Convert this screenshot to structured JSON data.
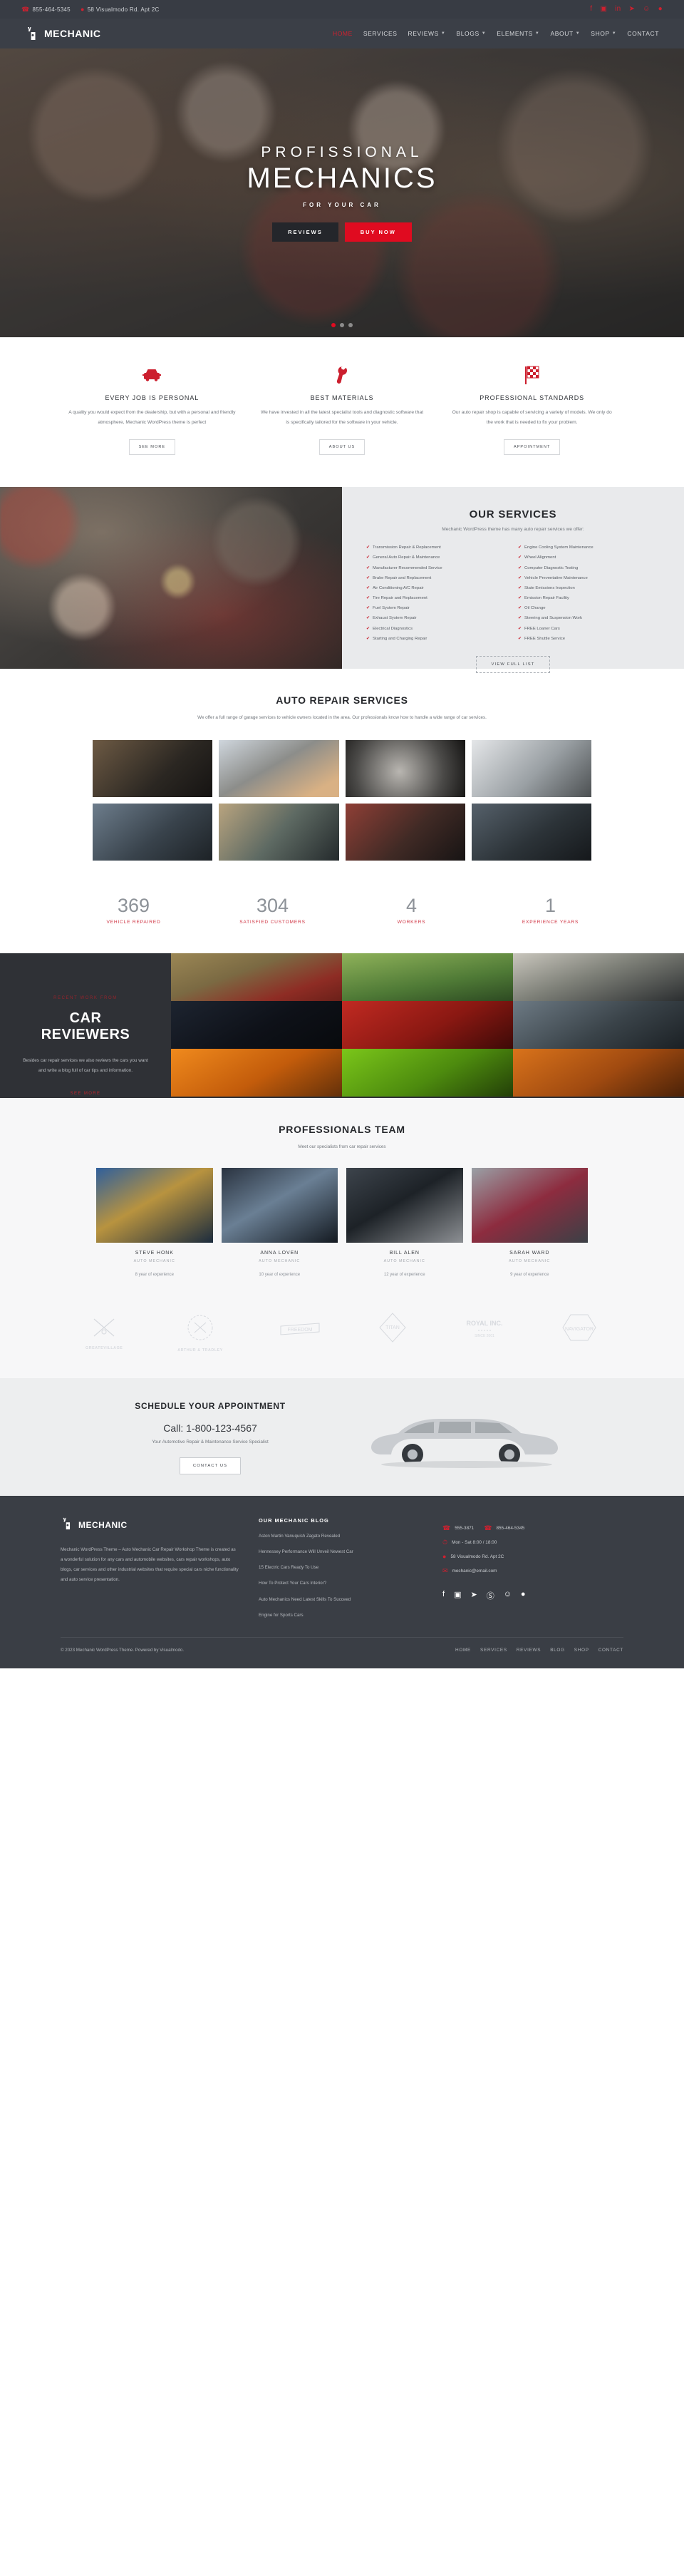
{
  "topbar": {
    "phone": "855-464-5345",
    "address": "58 Visualmodo Rd. Apt 2C",
    "socials": [
      "facebook-icon",
      "instagram-icon",
      "linkedin-icon",
      "twitter-icon",
      "yelp-icon",
      "wordpress-icon"
    ]
  },
  "nav": {
    "brand": "MECHANIC",
    "items": [
      {
        "label": "HOME",
        "active": true,
        "caret": false
      },
      {
        "label": "SERVICES",
        "active": false,
        "caret": false
      },
      {
        "label": "REVIEWS",
        "active": false,
        "caret": true
      },
      {
        "label": "BLOGS",
        "active": false,
        "caret": true
      },
      {
        "label": "ELEMENTS",
        "active": false,
        "caret": true
      },
      {
        "label": "ABOUT",
        "active": false,
        "caret": true
      },
      {
        "label": "SHOP",
        "active": false,
        "caret": true
      },
      {
        "label": "CONTACT",
        "active": false,
        "caret": false
      }
    ]
  },
  "hero": {
    "line1": "PROFISSIONAL",
    "line2": "MECHANICS",
    "tagline": "FOR YOUR CAR",
    "btn_reviews": "REVIEWS",
    "btn_buy": "BUY NOW"
  },
  "features": [
    {
      "icon": "car-icon",
      "title": "EVERY JOB IS PERSONAL",
      "text": "A quality you would expect from the dealership, but with a personal and friendly atmosphere, Mechanic WordPress theme is perfect",
      "button": "SEE MORE"
    },
    {
      "icon": "wrench-icon",
      "title": "BEST MATERIALS",
      "text": "We have invested in all the latest specialist tools and diagnostic software that is specifically tailored for the software in your vehicle.",
      "button": "ABOUT US"
    },
    {
      "icon": "checkered-flag-icon",
      "title": "PROFESSIONAL STANDARDS",
      "text": "Our auto repair shop is capable of servicing a variety of models. We only do the work that is needed to fix your problem.",
      "button": "APPOINTMENT"
    }
  ],
  "services": {
    "heading": "OUR SERVICES",
    "subheading": "Mechanic WordPress theme has many auto repair services we offer:",
    "col1": [
      "Transmission Repair & Replacement",
      "General Auto Repair & Maintenance",
      "Manufacturer Recommended Service",
      "Brake Repair and Replacement",
      "Air Conditioning A/C Repair",
      "Tire Repair and Replacement",
      "Fuel System Repair",
      "Exhaust System Repair",
      "Electrical Diagnostics",
      "Starting and Charging Repair"
    ],
    "col2": [
      "Engine Cooling System Maintenance",
      "Wheel Alignment",
      "Computer Diagnostic Testing",
      "Vehicle Preventative Maintenance",
      "State Emissions Inspection",
      "Emission Repair Facility",
      "Oil Change",
      "Steering and Suspension Work",
      "FREE Loaner Cars",
      "FREE Shuttle Service"
    ],
    "button": "VIEW FULL LIST"
  },
  "gallery": {
    "heading": "AUTO REPAIR SERVICES",
    "subheading": "We offer a full range of garage services to vehicle owners located in the area. Our professionals know how to handle a wide range of car services."
  },
  "counters": [
    {
      "value": "369",
      "label": "VEHICLE REPAIRED"
    },
    {
      "value": "304",
      "label": "SATISFIED CUSTOMERS"
    },
    {
      "value": "4",
      "label": "WORKERS"
    },
    {
      "value": "1",
      "label": "EXPERIENCE YEARS"
    }
  ],
  "reviewers": {
    "kicker": "RECENT WORK FROM",
    "heading_line1": "CAR",
    "heading_line2": "REVIEWERS",
    "text": "Besides car repair services we also reviews the cars you want and write a blog full of car tips and information.",
    "link": "SEE MORE"
  },
  "team": {
    "heading": "PROFESSIONALS TEAM",
    "subheading": "Meet our specialists from car repair services",
    "members": [
      {
        "name": "STEVE HONK",
        "role": "AUTO MECHANIC",
        "exp": "8 year of experience"
      },
      {
        "name": "ANNA LOVEN",
        "role": "AUTO MECHANIC",
        "exp": "10 year of experience"
      },
      {
        "name": "BILL ALEN",
        "role": "AUTO MECHANIC",
        "exp": "12 year of experience"
      },
      {
        "name": "SARAH WARD",
        "role": "AUTO MECHANIC",
        "exp": "9 year of experience"
      }
    ]
  },
  "brands": [
    {
      "name": "GREATEVILLAGE",
      "icon": "crossed-arrows-icon"
    },
    {
      "name": "ARTHUR & TRADLEY",
      "icon": "badge-seal-icon"
    },
    {
      "name": "FREEDOM",
      "icon": "ribbon-banner-icon"
    },
    {
      "name": "TITAN",
      "icon": "diamond-icon"
    },
    {
      "name": "ROYAL INC.",
      "icon": "royal-text-icon"
    },
    {
      "name": "NAVIGATOR",
      "icon": "hexagon-icon"
    }
  ],
  "appointment": {
    "heading": "SCHEDULE YOUR APPOINTMENT",
    "call": "Call: 1-800-123-4567",
    "sub": "Your Automotive Repair & Maintenance Service Specialist",
    "button": "CONTACT US"
  },
  "footer": {
    "brand": "MECHANIC",
    "about": "Mechanic WordPress Theme – Auto Mechanic Car Repair Workshop Theme is created as a wonderful solution for any cars and automobile websites, cars repair workshops, auto blogs, car services and other industrial websites that require special cars niche functionality and auto service presentation.",
    "blog_heading": "OUR MECHANIC BLOG",
    "blog_links": [
      "Aston Martin Vanuquish Zagato Revealed",
      "Hennessey Performance Will Unveil Newest Car",
      "15 Electric Cars Ready To Use",
      "How To Protect Your Cars Interior?",
      "Auto Mechanics Need Latest Skills To Succeed",
      "Engine for Sports Cars"
    ],
    "phone1": "555-3871",
    "phone2": "855-464-5345",
    "hours": "Mon - Sat 8:00 / 18:00",
    "address": "58 Visualmodo Rd. Apt 2C",
    "email": "mechanic@email.com",
    "socials": [
      "facebook-icon",
      "instagram-icon",
      "twitter-icon",
      "wordpress-icon",
      "yelp-icon",
      "pinterest-icon"
    ],
    "copyright": "© 2023 Mechanic WordPress Theme. Powered by Visualmodo.",
    "nav": [
      "HOME",
      "SERVICES",
      "REVIEWS",
      "BLOG",
      "SHOP",
      "CONTACT"
    ]
  },
  "colors": {
    "red": "#d0202f",
    "hero_red": "#e00b20",
    "dark": "#3a3e45"
  }
}
